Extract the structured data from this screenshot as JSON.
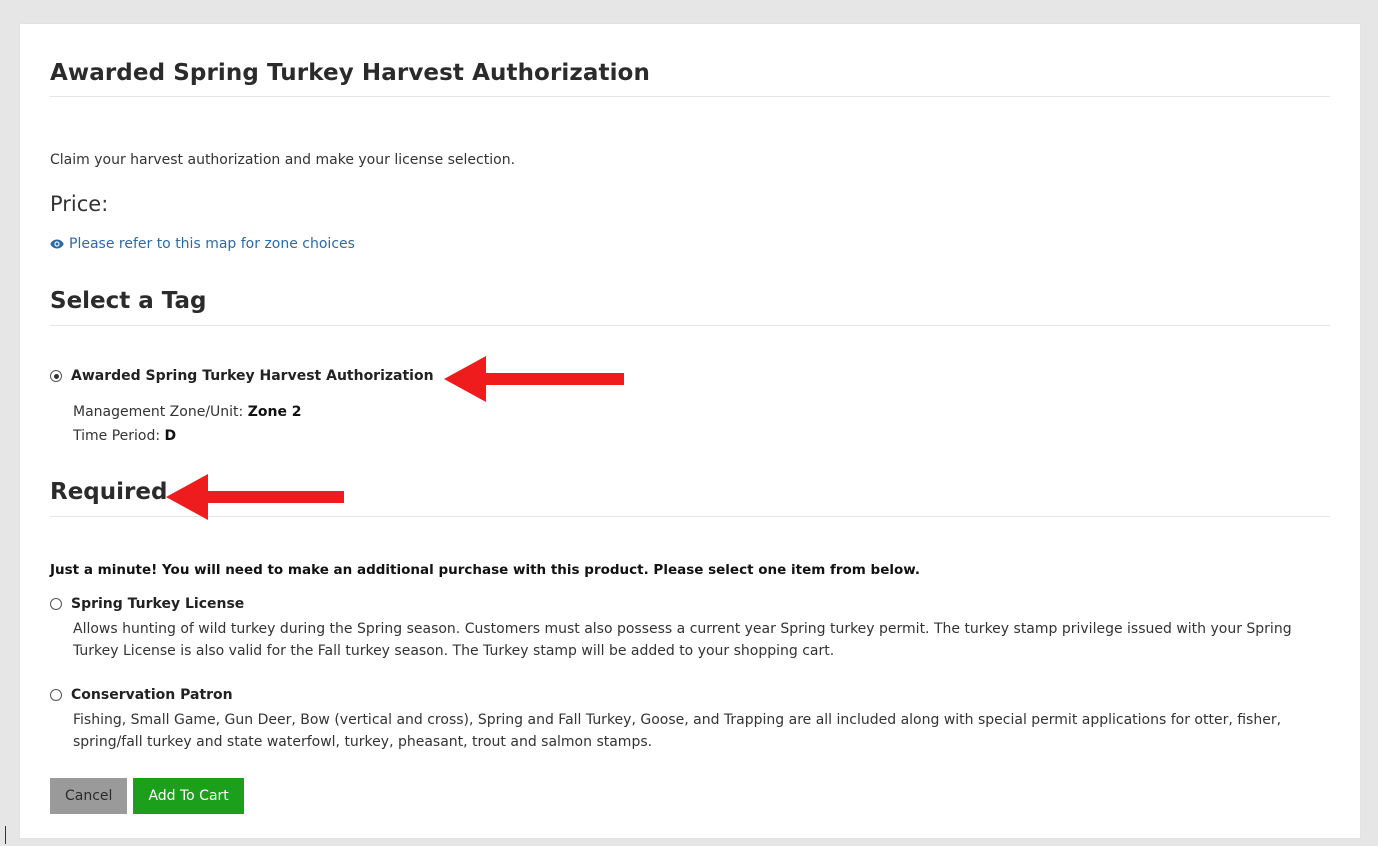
{
  "page": {
    "title": "Awarded Spring Turkey Harvest Authorization",
    "intro": "Claim your harvest authorization and make your license selection.",
    "price_label": "Price:",
    "map_link": {
      "icon": "eye-icon",
      "text": "Please refer to this map for zone choices"
    }
  },
  "select_tag": {
    "heading": "Select a Tag",
    "option": {
      "label": "Awarded Spring Turkey Harvest Authorization",
      "selected": true,
      "zone_label": "Management Zone/Unit:",
      "zone_value": "Zone 2",
      "period_label": "Time Period:",
      "period_value": "D"
    }
  },
  "required": {
    "heading": "Required",
    "notice": "Just a minute!  You will need to make an additional purchase with this product.  Please select one item from below.",
    "options": [
      {
        "label": "Spring Turkey License",
        "selected": false,
        "description": "Allows hunting of wild turkey during the Spring season. Customers must also possess a current year Spring turkey permit. The turkey stamp privilege issued with your Spring Turkey License is also valid for the Fall turkey season. The Turkey stamp will be added to your shopping cart."
      },
      {
        "label": "Conservation Patron",
        "selected": false,
        "description": "Fishing, Small Game, Gun Deer, Bow (vertical and cross), Spring and Fall Turkey, Goose, and Trapping are all included along with special permit applications for otter, fisher, spring/fall turkey and state waterfowl, turkey, pheasant, trout and salmon stamps."
      }
    ]
  },
  "buttons": {
    "cancel": "Cancel",
    "add_to_cart": "Add To Cart"
  },
  "colors": {
    "link": "#2c6aa4",
    "add_button": "#1ca01c",
    "cancel_button": "#9a9a9a",
    "annotation_arrow": "#ee1c1c"
  }
}
